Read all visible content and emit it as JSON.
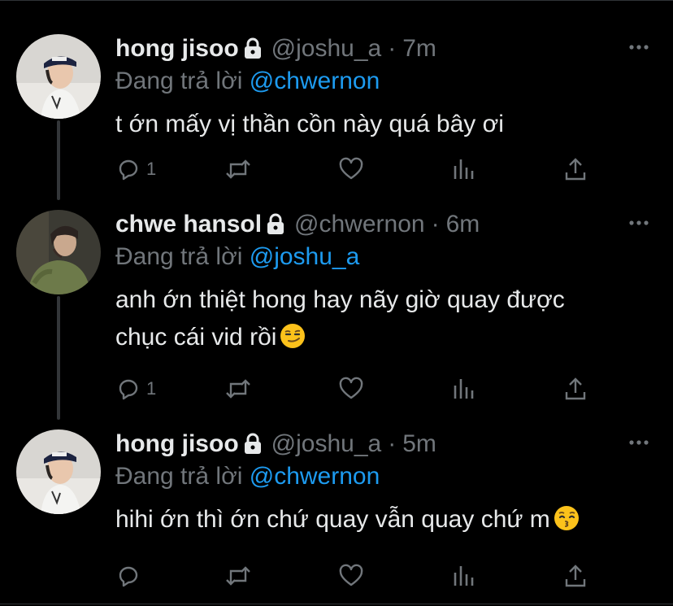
{
  "colors": {
    "background": "#000000",
    "text_primary": "#e7e9ea",
    "text_secondary": "#71767b",
    "mention": "#1d9bf0",
    "thread_line": "#333639"
  },
  "tweets": [
    {
      "display_name": "hong jisoo",
      "protected_icon": "lock-icon",
      "handle": "@joshu_a",
      "separator": "·",
      "time": "7m",
      "reply_prefix": "Đang trả lời",
      "reply_to": "@chwernon",
      "text": "t ớn mấy vị thần cồn này quá bây ơi",
      "reply_count": "1",
      "more_icon": "more-icon"
    },
    {
      "display_name": "chwe hansol",
      "protected_icon": "lock-icon",
      "handle": "@chwernon",
      "separator": "·",
      "time": "6m",
      "reply_prefix": "Đang trả lời",
      "reply_to": "@joshu_a",
      "text_line1": "anh ớn thiệt hong hay nãy giờ quay được",
      "text_line2": "chục cái vid rồi",
      "emoji": "smirking-face-emoji",
      "reply_count": "1",
      "more_icon": "more-icon"
    },
    {
      "display_name": "hong jisoo",
      "protected_icon": "lock-icon",
      "handle": "@joshu_a",
      "separator": "·",
      "time": "5m",
      "reply_prefix": "Đang trả lời",
      "reply_to": "@chwernon",
      "text": "hihi ớn thì ớn chứ quay vẫn quay chứ m",
      "emoji": "kissing-face-emoji",
      "reply_count": "",
      "more_icon": "more-icon"
    }
  ],
  "action_icons": [
    "reply-icon",
    "retweet-icon",
    "like-icon",
    "analytics-icon",
    "share-icon"
  ]
}
